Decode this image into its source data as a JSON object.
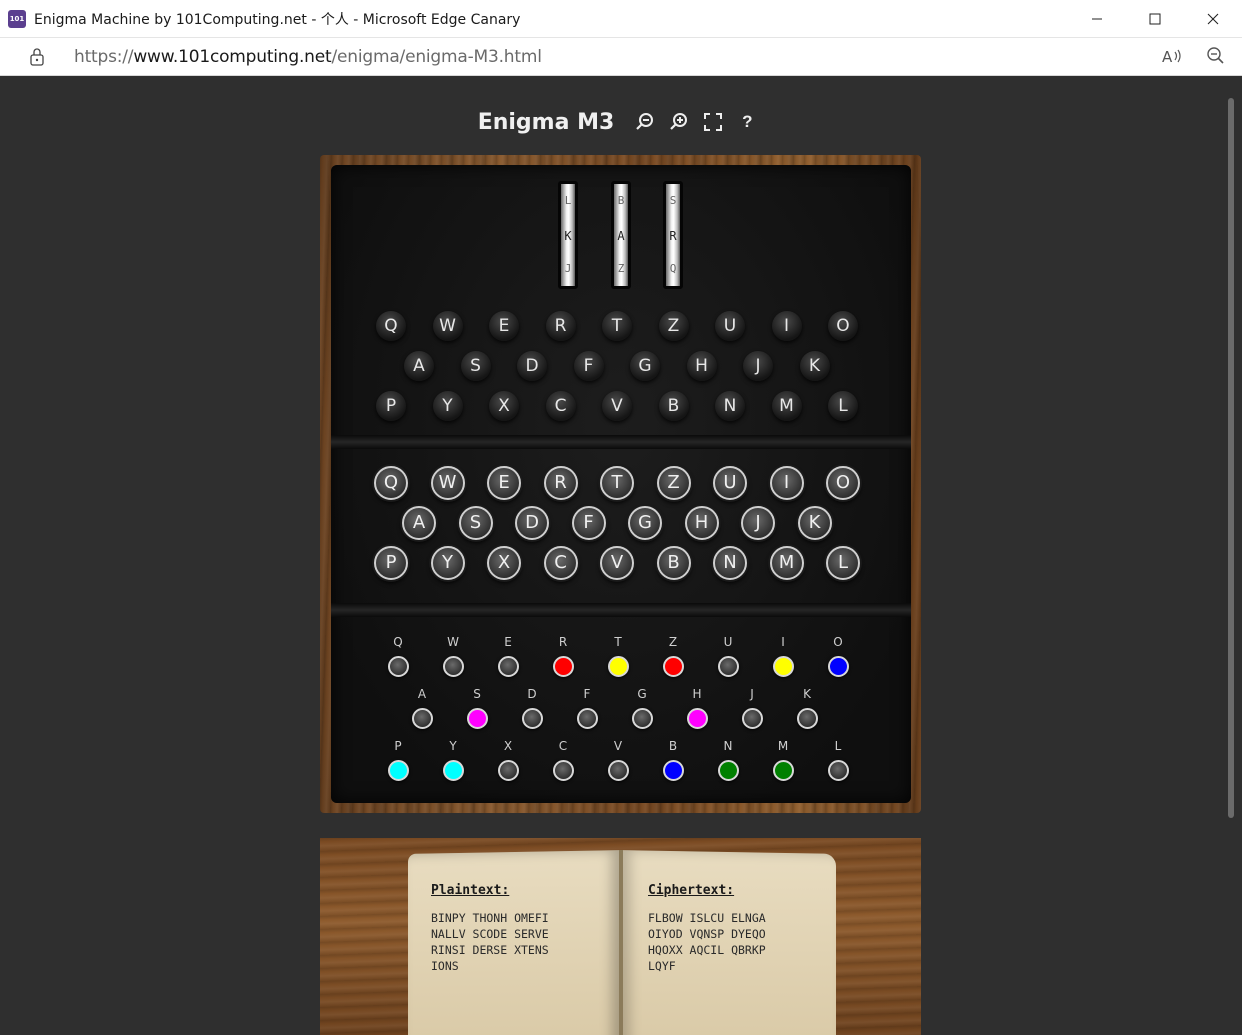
{
  "window": {
    "title": "Enigma Machine by 101Computing.net - 个人 - Microsoft Edge Canary",
    "app_icon_text": "101"
  },
  "address": {
    "scheme": "https://",
    "host": "www.101computing.net",
    "path": "/enigma/enigma-M3.html"
  },
  "header": {
    "title": "Enigma M3",
    "help_label": "?"
  },
  "rotors": [
    {
      "prev": "L",
      "current": "K",
      "next": "J"
    },
    {
      "prev": "B",
      "current": "A",
      "next": "Z"
    },
    {
      "prev": "S",
      "current": "R",
      "next": "Q"
    }
  ],
  "lampboard": {
    "rows": [
      [
        "Q",
        "W",
        "E",
        "R",
        "T",
        "Z",
        "U",
        "I",
        "O"
      ],
      [
        "A",
        "S",
        "D",
        "F",
        "G",
        "H",
        "J",
        "K"
      ],
      [
        "P",
        "Y",
        "X",
        "C",
        "V",
        "B",
        "N",
        "M",
        "L"
      ]
    ]
  },
  "keyboard": {
    "rows": [
      [
        "Q",
        "W",
        "E",
        "R",
        "T",
        "Z",
        "U",
        "I",
        "O"
      ],
      [
        "A",
        "S",
        "D",
        "F",
        "G",
        "H",
        "J",
        "K"
      ],
      [
        "P",
        "Y",
        "X",
        "C",
        "V",
        "B",
        "N",
        "M",
        "L"
      ]
    ]
  },
  "plugboard": {
    "rows": [
      [
        {
          "letter": "Q",
          "color": "#4a4a4a"
        },
        {
          "letter": "W",
          "color": "#4a4a4a"
        },
        {
          "letter": "E",
          "color": "#4a4a4a"
        },
        {
          "letter": "R",
          "color": "#ff0000"
        },
        {
          "letter": "T",
          "color": "#ffff00"
        },
        {
          "letter": "Z",
          "color": "#ff0000"
        },
        {
          "letter": "U",
          "color": "#4a4a4a"
        },
        {
          "letter": "I",
          "color": "#ffff00"
        },
        {
          "letter": "O",
          "color": "#0000ff"
        }
      ],
      [
        {
          "letter": "A",
          "color": "#4a4a4a"
        },
        {
          "letter": "S",
          "color": "#ff00ff"
        },
        {
          "letter": "D",
          "color": "#4a4a4a"
        },
        {
          "letter": "F",
          "color": "#4a4a4a"
        },
        {
          "letter": "G",
          "color": "#4a4a4a"
        },
        {
          "letter": "H",
          "color": "#ff00ff"
        },
        {
          "letter": "J",
          "color": "#4a4a4a"
        },
        {
          "letter": "K",
          "color": "#4a4a4a"
        }
      ],
      [
        {
          "letter": "P",
          "color": "#00ffff"
        },
        {
          "letter": "Y",
          "color": "#00ffff"
        },
        {
          "letter": "X",
          "color": "#4a4a4a"
        },
        {
          "letter": "C",
          "color": "#4a4a4a"
        },
        {
          "letter": "V",
          "color": "#4a4a4a"
        },
        {
          "letter": "B",
          "color": "#0000ff"
        },
        {
          "letter": "N",
          "color": "#008000"
        },
        {
          "letter": "M",
          "color": "#008000"
        },
        {
          "letter": "L",
          "color": "#4a4a4a"
        }
      ]
    ]
  },
  "book": {
    "plaintext_heading": "Plaintext:",
    "plaintext": "BINPY THONH OMEFI\nNALLV SCODE SERVE\nRINSI DERSE XTENS\nIONS",
    "ciphertext_heading": "Ciphertext:",
    "ciphertext": "FLBOW ISLCU ELNGA\nOIYOD VQNSP DYEQO\nHQOXX AQCIL QBRKP\nLQYF"
  }
}
